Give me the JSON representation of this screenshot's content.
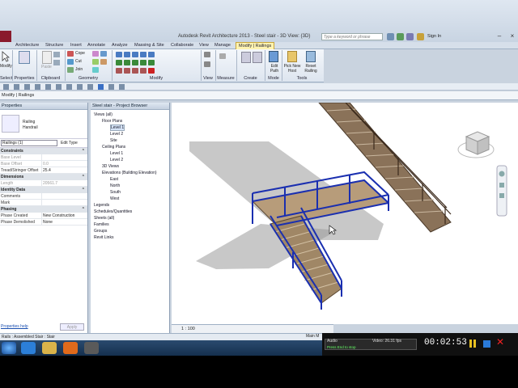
{
  "app": {
    "title": "Autodesk Revit Architecture 2013 -     Steel stair - 3D View: {3D}",
    "search_placeholder": "Type a keyword or phrase",
    "sign_in": "Sign In"
  },
  "tabs": [
    "Architecture",
    "Structure",
    "Insert",
    "Annotate",
    "Analyze",
    "Massing & Site",
    "Collaborate",
    "View",
    "Manage",
    "Modify | Railings"
  ],
  "ribbon": {
    "select_label": "Select",
    "modify_label": "Modify",
    "properties_label": "Properties",
    "clipboard_label": "Clipboard",
    "paste_label": "Paste",
    "cope_label": "Cope",
    "cut_label": "Cut",
    "join_label": "Join",
    "geometry_label": "Geometry",
    "modify_group_label": "Modify",
    "view_label": "View",
    "measure_label": "Measure",
    "create_label": "Create",
    "edit_path_label": "Edit Path",
    "mode_label": "Mode",
    "pick_new_host_label": "Pick New Host",
    "reset_railing_label": "Reset Railing",
    "tools_label": "Tools"
  },
  "context_bar": "Modify | Railings",
  "properties": {
    "header": "Properties",
    "type_name": "Railing",
    "type_sub": "Handrail",
    "selector": "Railings (1)",
    "edit_type": "Edit Type",
    "groups": [
      {
        "name": "Constraints",
        "rows": [
          {
            "k": "Base Level",
            "v": "",
            "grey": true
          },
          {
            "k": "Base Offset",
            "v": "0.0",
            "grey": true
          },
          {
            "k": "Tread/Stringer Offset",
            "v": "25.4",
            "grey": false
          }
        ]
      },
      {
        "name": "Dimensions",
        "rows": [
          {
            "k": "Length",
            "v": "20561.7",
            "grey": true
          }
        ]
      },
      {
        "name": "Identity Data",
        "rows": [
          {
            "k": "Comments",
            "v": "",
            "grey": false
          },
          {
            "k": "Mark",
            "v": "",
            "grey": false
          }
        ]
      },
      {
        "name": "Phasing",
        "rows": [
          {
            "k": "Phase Created",
            "v": "New Construction",
            "grey": false
          },
          {
            "k": "Phase Demolished",
            "v": "None",
            "grey": false
          }
        ]
      }
    ],
    "help_link": "Properties help",
    "apply": "Apply"
  },
  "browser": {
    "header": "Steel stair - Project Browser",
    "items": [
      {
        "indent": 0,
        "text": "Views (all)",
        "sel": false
      },
      {
        "indent": 1,
        "text": "Floor Plans",
        "sel": false
      },
      {
        "indent": 2,
        "text": "Level 1",
        "sel": true
      },
      {
        "indent": 2,
        "text": "Level 2",
        "sel": false
      },
      {
        "indent": 2,
        "text": "Site",
        "sel": false
      },
      {
        "indent": 1,
        "text": "Ceiling Plans",
        "sel": false
      },
      {
        "indent": 2,
        "text": "Level 1",
        "sel": false
      },
      {
        "indent": 2,
        "text": "Level 2",
        "sel": false
      },
      {
        "indent": 1,
        "text": "3D Views",
        "sel": false
      },
      {
        "indent": 1,
        "text": "Elevations (Building Elevation)",
        "sel": false
      },
      {
        "indent": 2,
        "text": "East",
        "sel": false
      },
      {
        "indent": 2,
        "text": "North",
        "sel": false
      },
      {
        "indent": 2,
        "text": "South",
        "sel": false
      },
      {
        "indent": 2,
        "text": "West",
        "sel": false
      },
      {
        "indent": 0,
        "text": "Legends",
        "sel": false
      },
      {
        "indent": 0,
        "text": "Schedules/Quantities",
        "sel": false
      },
      {
        "indent": 0,
        "text": "Sheets (all)",
        "sel": false
      },
      {
        "indent": 0,
        "text": "Families",
        "sel": false
      },
      {
        "indent": 0,
        "text": "Groups",
        "sel": false
      },
      {
        "indent": 0,
        "text": "Revit Links",
        "sel": false
      }
    ]
  },
  "viewbar": {
    "scale": "1 : 100"
  },
  "status": {
    "text": "Rails : Assembled Stair : Stair",
    "main_model": "Main M"
  },
  "recorder": {
    "audio": "Audio",
    "video": "Video: 26.31 fps",
    "stop_hint": "Press End to stop",
    "time": "00:02:53"
  },
  "colors": {
    "accent": "#fff3b0",
    "railing_selected": "#1a2fb0"
  }
}
